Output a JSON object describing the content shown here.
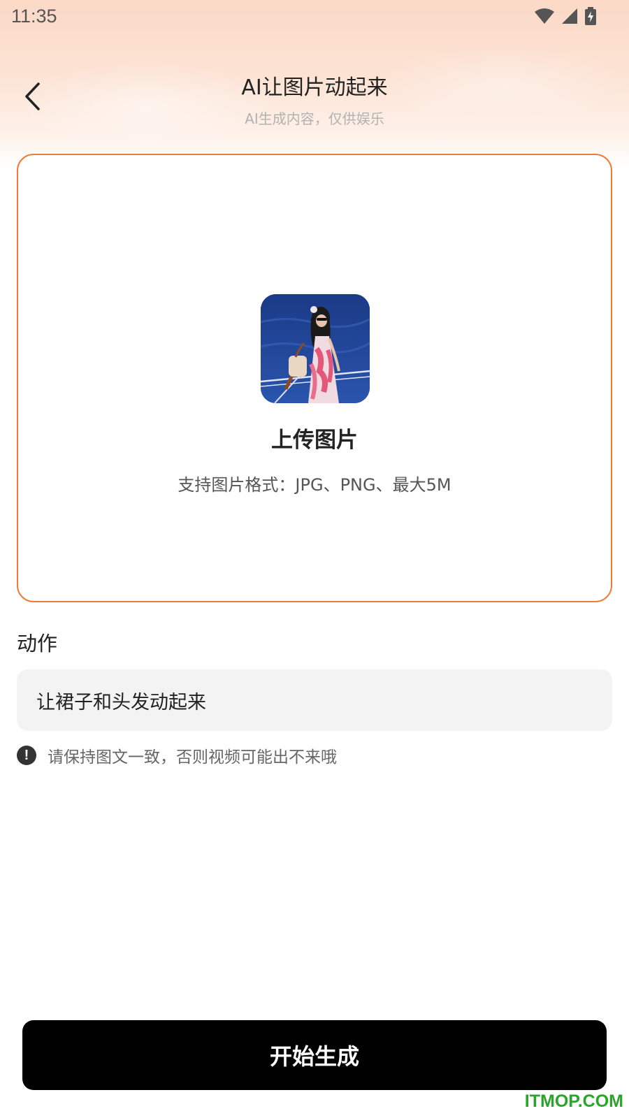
{
  "status_bar": {
    "time": "11:35",
    "icons": [
      "wifi-icon",
      "signal-icon",
      "battery-charging-icon"
    ]
  },
  "header": {
    "back_icon": "chevron-left-icon",
    "title": "AI让图片动起来",
    "subtitle": "AI生成内容，仅供娱乐"
  },
  "upload": {
    "title": "上传图片",
    "hint": "支持图片格式：JPG、PNG、最大5M",
    "border_color": "#f07a3a"
  },
  "action": {
    "label": "动作",
    "value": "让裙子和头发动起来",
    "warning_icon": "exclamation-circle-icon",
    "warning": "请保持图文一致，否则视频可能出不来哦"
  },
  "primary_button": {
    "label": "开始生成"
  },
  "watermark": "ITMOP.COM",
  "colors": {
    "accent": "#f07a3a",
    "button_bg": "#000000",
    "input_bg": "#f3f3f3",
    "header_gradient": "#fbd9c6"
  }
}
